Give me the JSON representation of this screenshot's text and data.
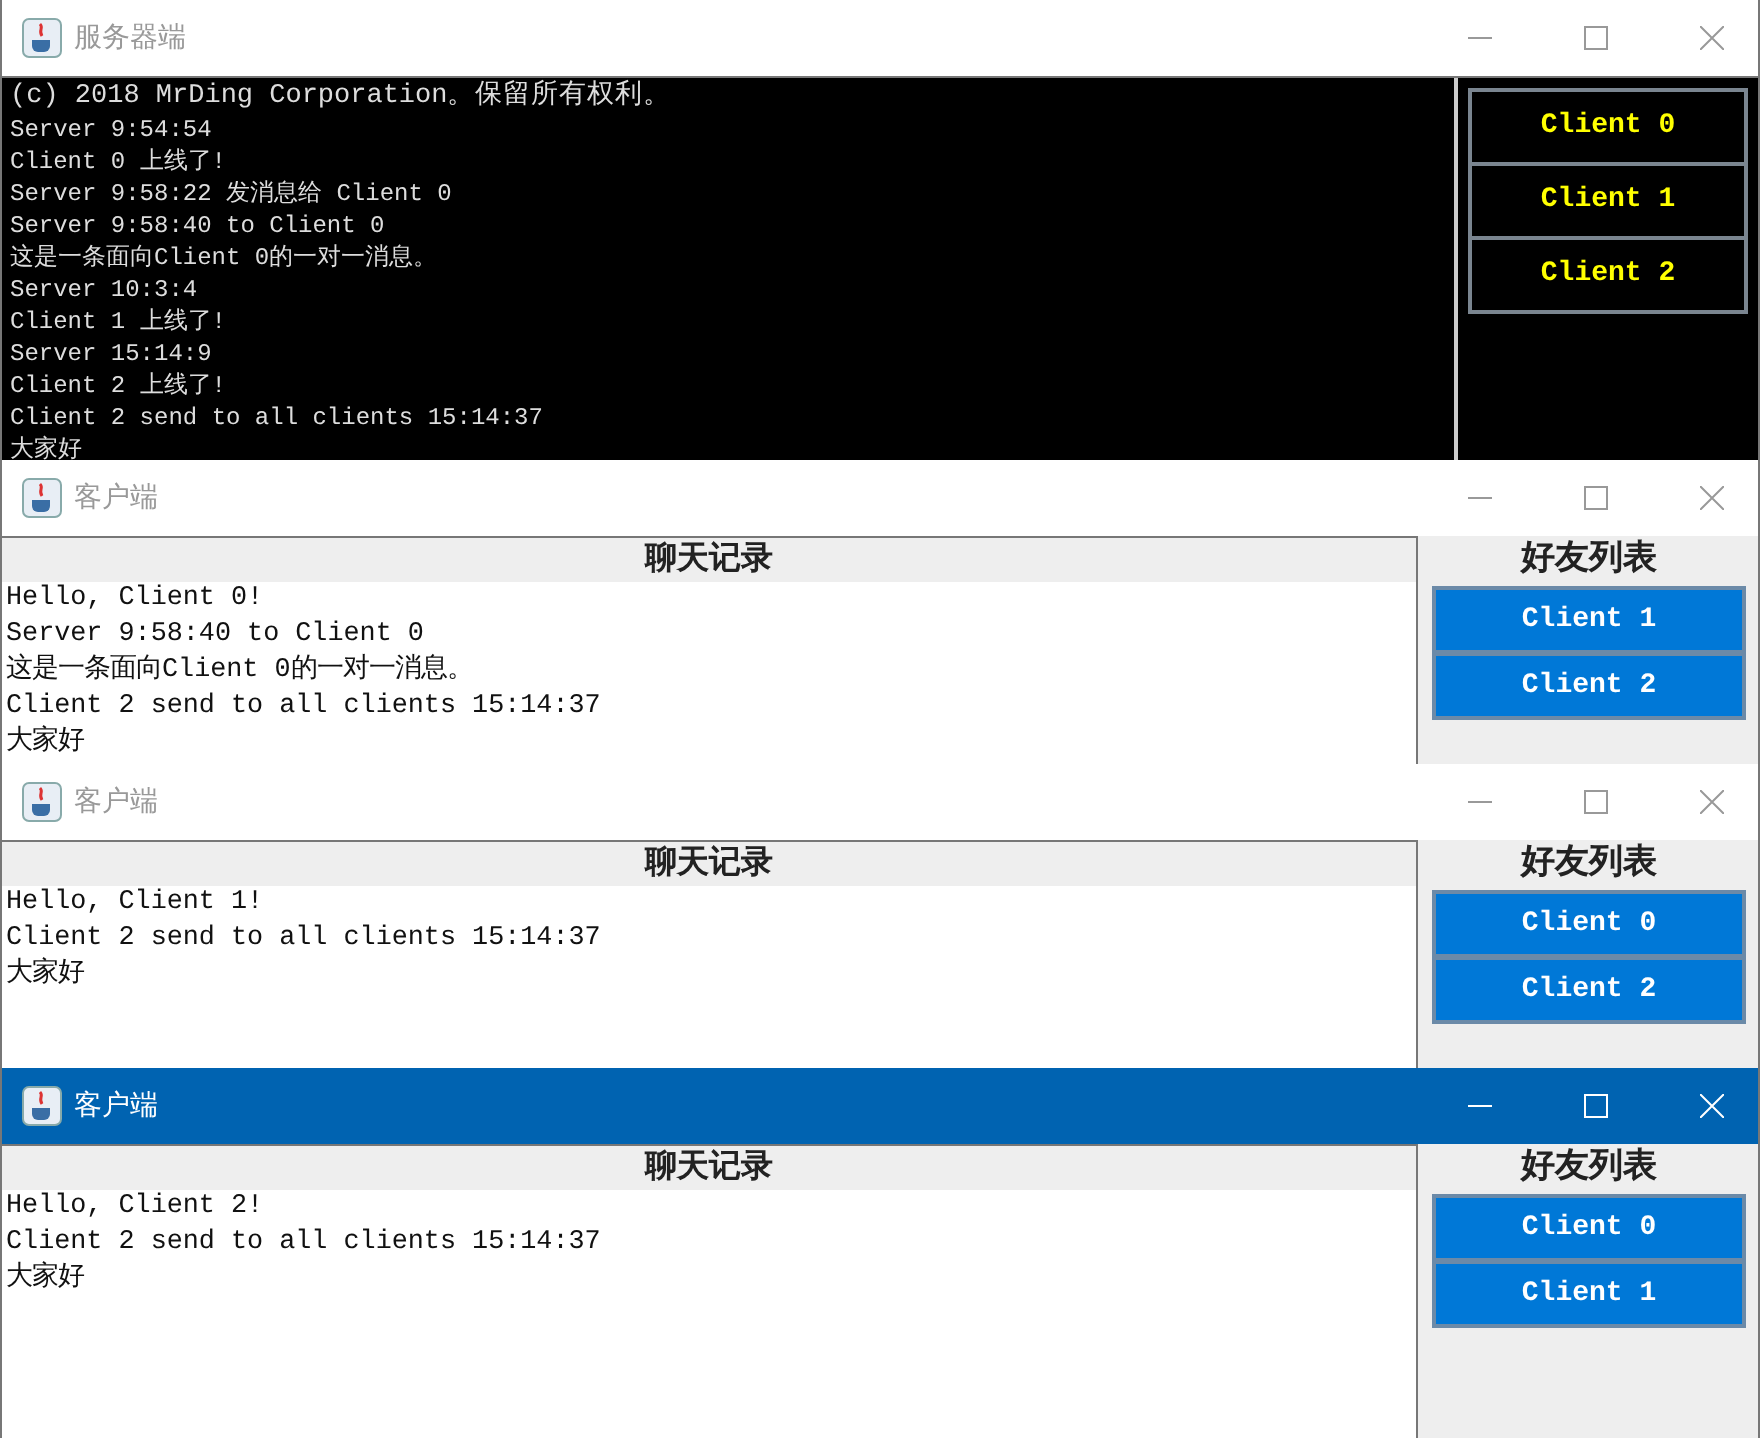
{
  "windows": [
    {
      "kind": "server",
      "title": "服务器端",
      "active": false,
      "log": [
        "(c) 2018 MrDing Corporation。保留所有权利。",
        "Server 9:54:54",
        "Client 0 上线了!",
        "Server 9:58:22 发消息给 Client 0",
        "Server 9:58:40 to Client 0",
        "这是一条面向Client 0的一对一消息。",
        "Server 10:3:4",
        "Client 1 上线了!",
        "Server 15:14:9",
        "Client 2 上线了!",
        "Client 2 send to all clients 15:14:37",
        "大家好"
      ],
      "clients": [
        "Client 0",
        "Client 1",
        "Client 2"
      ]
    },
    {
      "kind": "client",
      "title": "客户端",
      "active": false,
      "chat_header": "聊天记录",
      "messages": [
        "Hello, Client 0!",
        "Server 9:58:40 to Client 0",
        "这是一条面向Client 0的一对一消息。",
        "Client 2 send to all clients 15:14:37",
        "大家好"
      ],
      "friends_header": "好友列表",
      "friends": [
        "Client 1",
        "Client 2"
      ]
    },
    {
      "kind": "client",
      "title": "客户端",
      "active": false,
      "chat_header": "聊天记录",
      "messages": [
        "Hello, Client 1!",
        "Client 2 send to all clients 15:14:37",
        "大家好"
      ],
      "friends_header": "好友列表",
      "friends": [
        "Client 0",
        "Client 2"
      ]
    },
    {
      "kind": "client",
      "title": "客户端",
      "active": true,
      "chat_header": "聊天记录",
      "messages": [
        "Hello, Client 2!",
        "Client 2 send to all clients 15:14:37",
        "大家好"
      ],
      "friends_header": "好友列表",
      "friends": [
        "Client 0",
        "Client 1"
      ]
    }
  ]
}
